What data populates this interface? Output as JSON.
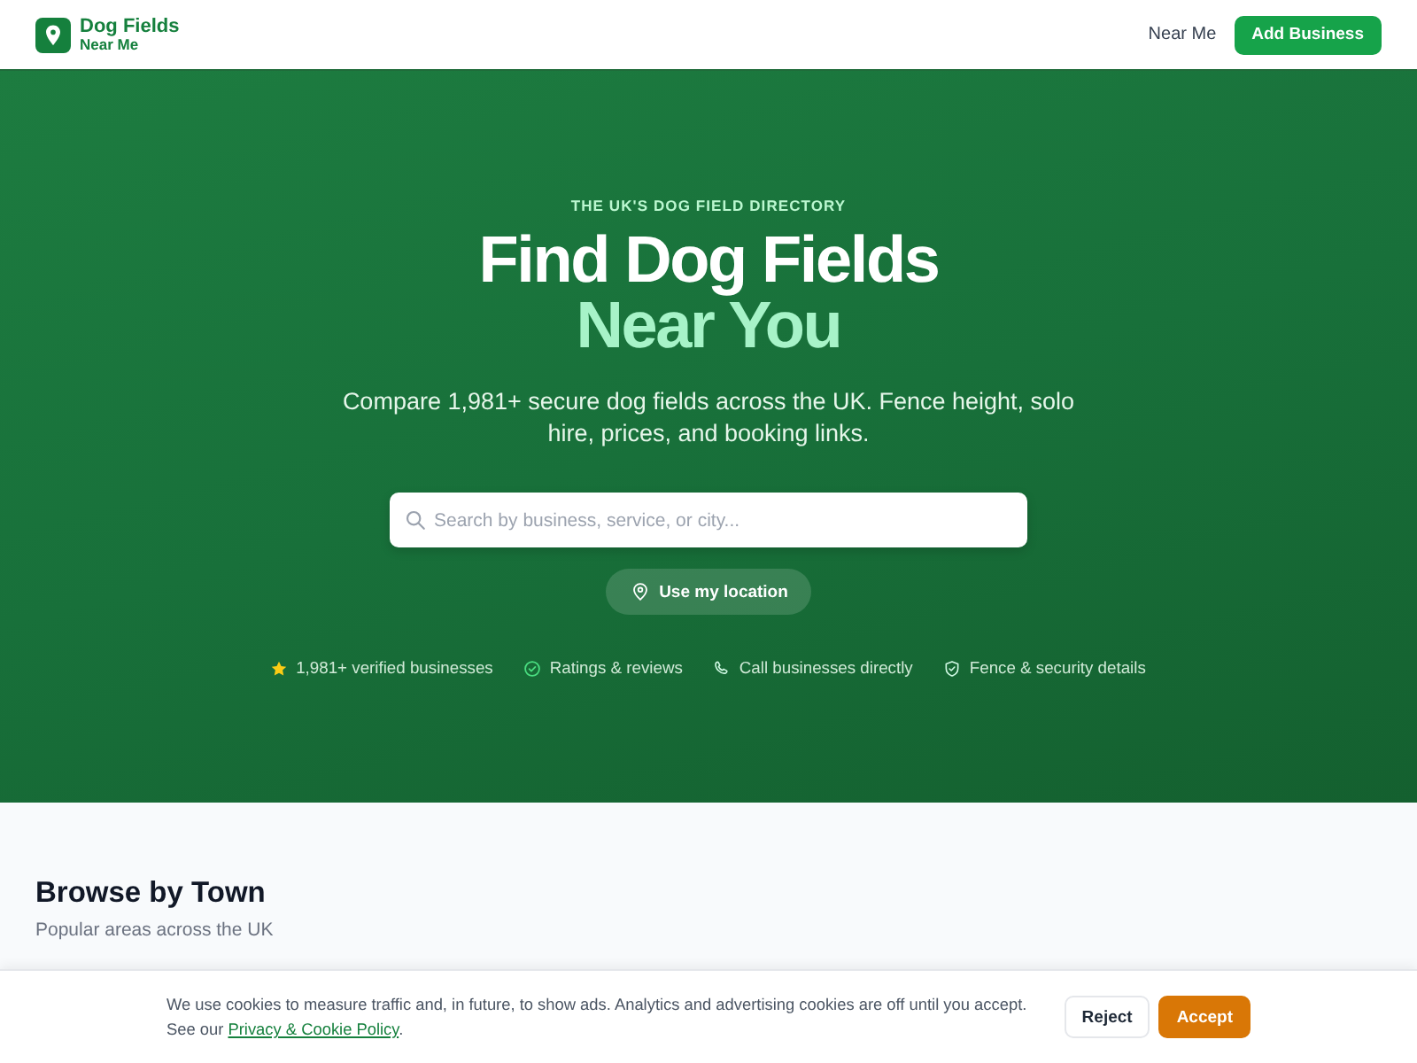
{
  "header": {
    "logo": {
      "title": "Dog Fields",
      "subtitle": "Near Me"
    },
    "nav_links": [
      "Near Me"
    ],
    "cta": "Add Business"
  },
  "hero": {
    "eyebrow": "THE UK'S DOG FIELD DIRECTORY",
    "title": "Find Dog Fields",
    "title_highlight": "Near You",
    "subtitle": "Compare 1,981+ secure dog fields across the UK. Fence height, solo hire, prices, and booking links.",
    "search": {
      "placeholder": "Search by business, service, or city..."
    },
    "location_button": "Use my location",
    "features": [
      "1,981+ verified businesses",
      "Ratings & reviews",
      "Call businesses directly",
      "Fence & security details"
    ]
  },
  "browse": {
    "title": "Browse by Town",
    "subtitle": "Popular areas across the UK"
  },
  "cookie_banner": {
    "message": "We use cookies to measure traffic and, in future, to show ads. Analytics and advertising cookies are off until you accept.",
    "policy_prefix": "See our",
    "policy_link": "Privacy & Cookie Policy",
    "policy_suffix": ".",
    "buttons": [
      {
        "label": "Reject",
        "kind": "secondary"
      },
      {
        "label": "Accept",
        "kind": "primary"
      }
    ]
  }
}
